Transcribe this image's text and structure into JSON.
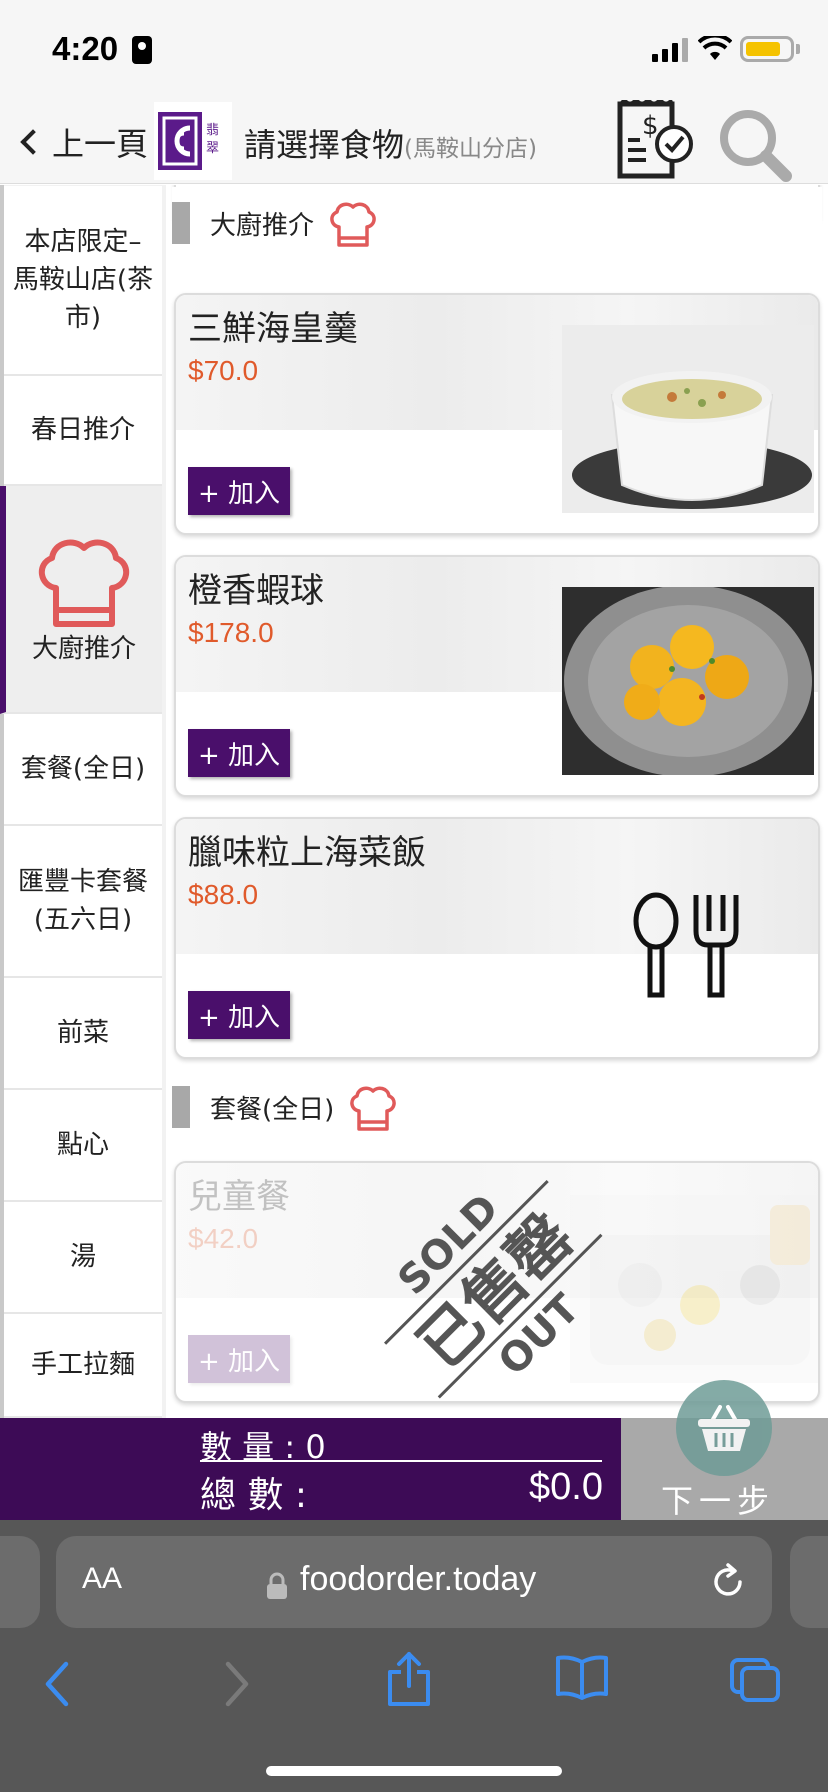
{
  "status": {
    "time": "4:20",
    "icons": [
      "portrait-lock-icon",
      "signal-icon",
      "wifi-icon",
      "battery-icon"
    ],
    "battery_color": "#f5c300"
  },
  "header": {
    "back_label": "上一頁",
    "title": "請選擇食物",
    "branch": "(馬鞍山分店)",
    "logo_text": "翡翠",
    "brand_color": "#4a0f6b"
  },
  "sidebar": {
    "items": [
      {
        "label": "本店限定–馬鞍山店(茶市)"
      },
      {
        "label": "春日推介"
      },
      {
        "label": "大廚推介"
      },
      {
        "label": "套餐(全日)"
      },
      {
        "label": "匯豐卡套餐(五六日)"
      },
      {
        "label": "前菜"
      },
      {
        "label": "點心"
      },
      {
        "label": "湯"
      },
      {
        "label": "手工拉麵"
      }
    ],
    "active_index": 2
  },
  "sections": [
    {
      "title": "大廚推介"
    },
    {
      "title": "套餐(全日)"
    }
  ],
  "dishes": [
    {
      "name": "三鮮海皇羹",
      "price": "$70.0",
      "add_label": "+ 加入"
    },
    {
      "name": "橙香蝦球",
      "price": "$178.0",
      "add_label": "+ 加入"
    },
    {
      "name": "臘味粒上海菜飯",
      "price": "$88.0",
      "add_label": "+ 加入"
    },
    {
      "name": "兒童餐",
      "price": "$42.0",
      "add_label": "+ 加入",
      "sold_out": true
    }
  ],
  "sold_out_stamp": {
    "top": "SOLD",
    "middle": "已售罄",
    "bottom": "OUT"
  },
  "cart": {
    "qty_label": "數 量 :",
    "qty_value": "0",
    "total_label": "總 數 :",
    "total_value": "$0.0",
    "next_label": "下一步"
  },
  "browser": {
    "aa_label": "AA",
    "url": "foodorder.today"
  }
}
